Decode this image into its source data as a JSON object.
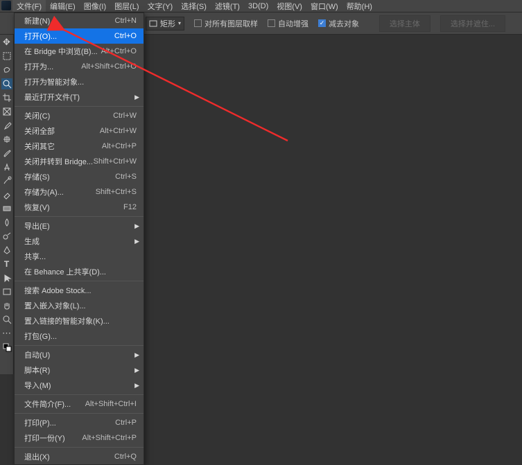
{
  "menubar": {
    "items": [
      "文件(F)",
      "编辑(E)",
      "图像(I)",
      "图层(L)",
      "文字(Y)",
      "选择(S)",
      "滤镜(T)",
      "3D(D)",
      "视图(V)",
      "窗口(W)",
      "帮助(H)"
    ]
  },
  "optbar": {
    "shape_label": "矩形",
    "chk_all_layers": "对所有图层取样",
    "chk_auto_enhance": "自动增强",
    "chk_subtract": "减去对象",
    "btn_select_subject": "选择主体",
    "btn_select_and_mask": "选择并遮住..."
  },
  "filemenu": {
    "items": [
      {
        "label": "新建(N)...",
        "sc": "Ctrl+N"
      },
      {
        "label": "打开(O)...",
        "sc": "Ctrl+O",
        "highlight": true
      },
      {
        "label": "在 Bridge 中浏览(B)...",
        "sc": "Alt+Ctrl+O"
      },
      {
        "label": "打开为...",
        "sc": "Alt+Shift+Ctrl+O"
      },
      {
        "label": "打开为智能对象..."
      },
      {
        "label": "最近打开文件(T)",
        "sub": true
      },
      {
        "sep": true
      },
      {
        "label": "关闭(C)",
        "sc": "Ctrl+W"
      },
      {
        "label": "关闭全部",
        "sc": "Alt+Ctrl+W"
      },
      {
        "label": "关闭其它",
        "sc": "Alt+Ctrl+P"
      },
      {
        "label": "关闭并转到 Bridge...",
        "sc": "Shift+Ctrl+W"
      },
      {
        "label": "存储(S)",
        "sc": "Ctrl+S"
      },
      {
        "label": "存储为(A)...",
        "sc": "Shift+Ctrl+S"
      },
      {
        "label": "恢复(V)",
        "sc": "F12"
      },
      {
        "sep": true
      },
      {
        "label": "导出(E)",
        "sub": true
      },
      {
        "label": "生成",
        "sub": true
      },
      {
        "label": "共享..."
      },
      {
        "label": "在 Behance 上共享(D)..."
      },
      {
        "sep": true
      },
      {
        "label": "搜索 Adobe Stock..."
      },
      {
        "label": "置入嵌入对象(L)..."
      },
      {
        "label": "置入链接的智能对象(K)..."
      },
      {
        "label": "打包(G)..."
      },
      {
        "sep": true
      },
      {
        "label": "自动(U)",
        "sub": true
      },
      {
        "label": "脚本(R)",
        "sub": true
      },
      {
        "label": "导入(M)",
        "sub": true
      },
      {
        "sep": true
      },
      {
        "label": "文件简介(F)...",
        "sc": "Alt+Shift+Ctrl+I"
      },
      {
        "sep": true
      },
      {
        "label": "打印(P)...",
        "sc": "Ctrl+P"
      },
      {
        "label": "打印一份(Y)",
        "sc": "Alt+Shift+Ctrl+P"
      },
      {
        "sep": true
      },
      {
        "label": "退出(X)",
        "sc": "Ctrl+Q"
      }
    ]
  },
  "tool_names": [
    "move",
    "marquee",
    "lasso",
    "quick-select",
    "crop",
    "frame",
    "eyedropper",
    "healing",
    "brush",
    "clone",
    "history-brush",
    "eraser",
    "gradient",
    "blur",
    "dodge",
    "pen",
    "type",
    "path-select",
    "rectangle",
    "hand",
    "zoom",
    "more"
  ]
}
